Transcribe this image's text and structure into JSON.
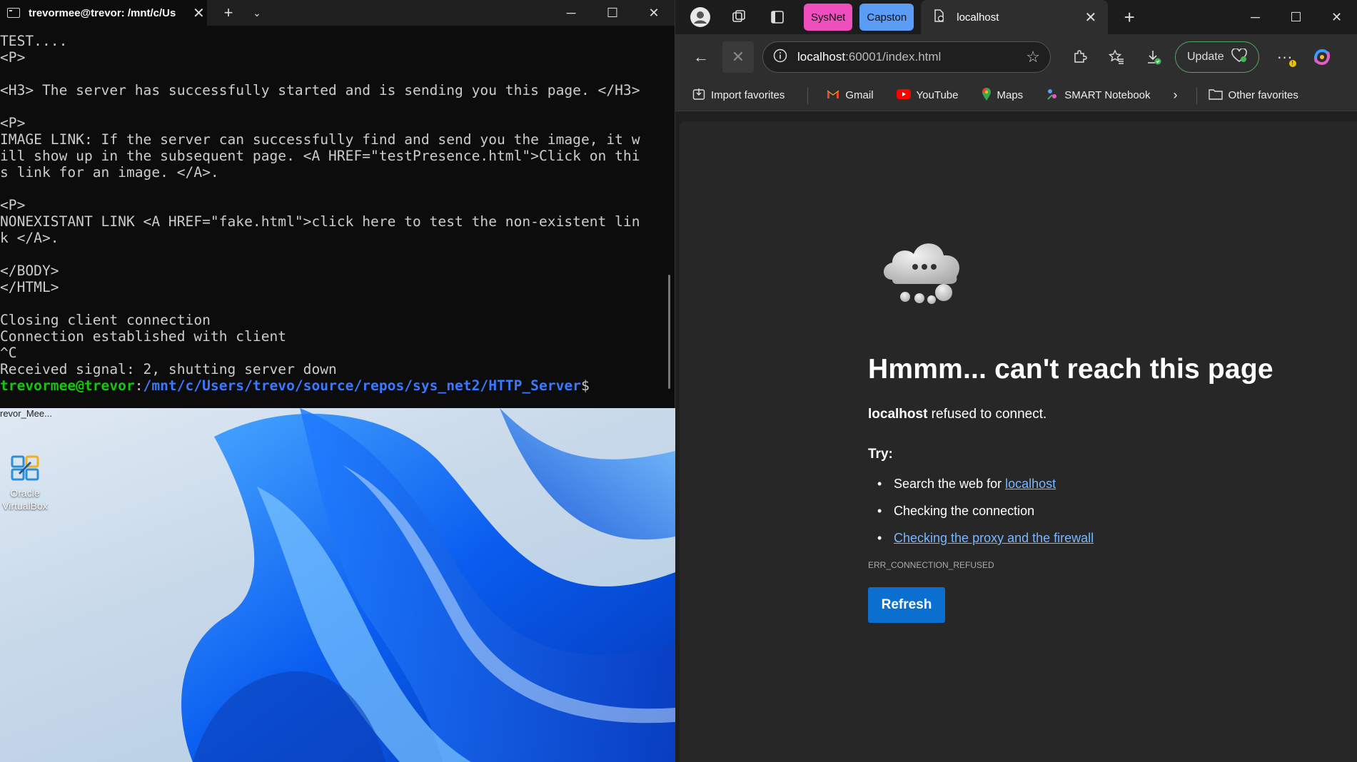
{
  "terminal": {
    "tab_title": "trevormee@trevor: /mnt/c/Us",
    "lines": [
      "TEST....",
      "<P>",
      "",
      "<H3> The server has successfully started and is sending you this page. </H3>",
      "",
      "<P>",
      "IMAGE LINK: If the server can successfully find and send you the image, it w",
      "ill show up in the subsequent page. <A HREF=\"testPresence.html\">Click on thi",
      "s link for an image. </A>.",
      "",
      "<P>",
      "NONEXISTANT LINK <A HREF=\"fake.html\">click here to test the non-existent lin",
      "k </A>.",
      "",
      "</BODY>",
      "</HTML>",
      "",
      "Closing client connection",
      "Connection established with client",
      "^C",
      "Received signal: 2, shutting server down"
    ],
    "prompt_user": "trevormee@trevor",
    "prompt_sep": ":",
    "prompt_path": "/mnt/c/Users/trevo/source/repos/sys_net2/HTTP_Server",
    "prompt_end": "$"
  },
  "desktop": {
    "clipped_label": "revor_Mee...",
    "vbox_label_1": "Oracle",
    "vbox_label_2": "VirtualBox"
  },
  "browser": {
    "tab_groups": [
      "SysNet",
      "Capston"
    ],
    "active_tab_title": "localhost",
    "address_host": "localhost",
    "address_rest": ":60001/index.html",
    "update_label": "Update",
    "favorites": [
      {
        "label": "Import favorites",
        "icon": "import-icon"
      },
      {
        "label": "Gmail",
        "icon": "gmail-icon"
      },
      {
        "label": "YouTube",
        "icon": "youtube-icon"
      },
      {
        "label": "Maps",
        "icon": "maps-icon"
      },
      {
        "label": "SMART Notebook",
        "icon": "smart-notebook-icon"
      }
    ],
    "other_favorites": "Other favorites",
    "error": {
      "title": "Hmmm... can't reach this page",
      "sub_bold": "localhost",
      "sub_rest": " refused to connect.",
      "try_label": "Try:",
      "item1_prefix": "Search the web for ",
      "item1_link": "localhost",
      "item2": "Checking the connection",
      "item3_link": "Checking the proxy and the firewall",
      "code": "ERR_CONNECTION_REFUSED",
      "refresh_label": "Refresh"
    }
  }
}
